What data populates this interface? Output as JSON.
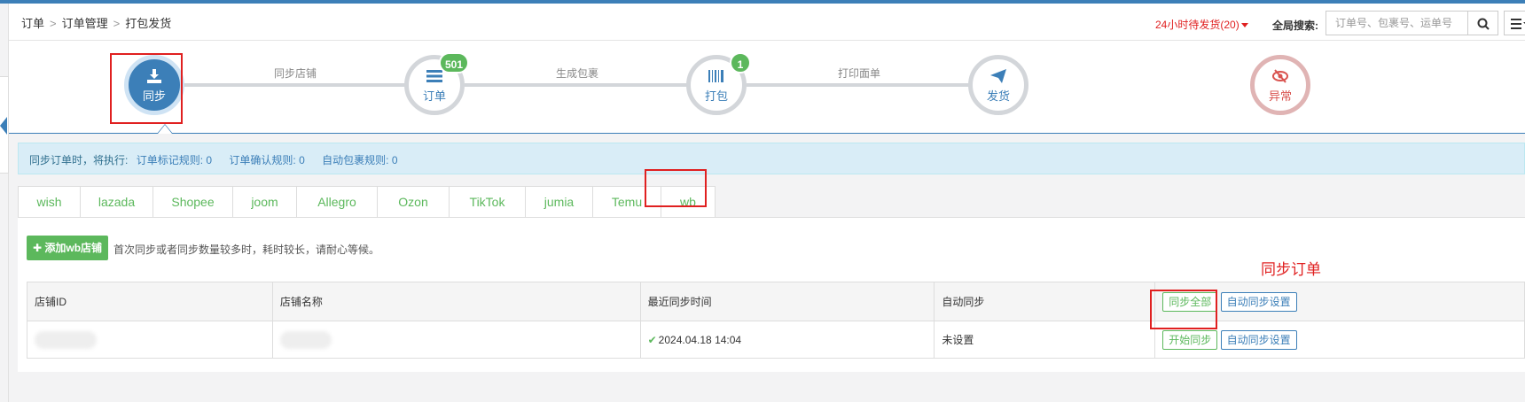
{
  "breadcrumb": [
    "订单",
    "订单管理",
    "打包发货"
  ],
  "header": {
    "pending": "24小时待发货(20)",
    "search_label": "全局搜索:",
    "search_placeholder": "订单号、包裹号、运单号"
  },
  "steps": [
    {
      "label": "同步",
      "icon": "download-icon"
    },
    {
      "label": "订单",
      "icon": "list-icon",
      "badge": "501"
    },
    {
      "label": "打包",
      "icon": "barcode-icon",
      "badge": "1"
    },
    {
      "label": "发货",
      "icon": "send-icon"
    },
    {
      "label": "异常",
      "icon": "eye-slash-icon"
    }
  ],
  "step_links": [
    "同步店铺",
    "生成包裹",
    "打印面单"
  ],
  "info": {
    "prefix": "同步订单时，将执行:",
    "mark_rule_label": "订单标记规则:",
    "mark_rule_count": "0",
    "confirm_rule_label": "订单确认规则:",
    "confirm_rule_count": "0",
    "auto_pack_label": "自动包裹规则:",
    "auto_pack_count": "0"
  },
  "platform_tabs": [
    "wish",
    "lazada",
    "Shopee",
    "joom",
    "Allegro",
    "Ozon",
    "TikTok",
    "jumia",
    "Temu",
    "wb"
  ],
  "active_tab": "wb",
  "add_shop_label": "添加wb店铺",
  "hint": "首次同步或者同步数量较多时，耗时较长，请耐心等候。",
  "annotation": "同步订单",
  "table": {
    "headers": [
      "店铺ID",
      "店铺名称",
      "最近同步时间",
      "自动同步"
    ],
    "header_actions": [
      "同步全部",
      "自动同步设置"
    ],
    "rows": [
      {
        "sync_time": "2024.04.18 14:04",
        "auto_sync": "未设置",
        "actions": [
          "开始同步",
          "自动同步设置"
        ]
      }
    ]
  },
  "colors": {
    "primary": "#3c7fb8",
    "success": "#5cb85c",
    "danger": "#e02020"
  }
}
